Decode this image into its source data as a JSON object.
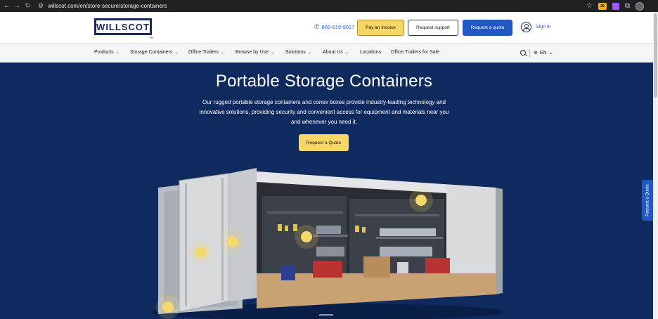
{
  "browser": {
    "url": "willscot.com/en/store-secure/storage-containers",
    "ext_badge": "20"
  },
  "header": {
    "logo_text": "WILLSCOT",
    "logo_tm": "TM",
    "phone": "866-619-9017",
    "pay_invoice": "Pay an Invoice",
    "request_support": "Request support",
    "request_quote": "Request a quote",
    "sign_in": "Sign in"
  },
  "nav": {
    "items": [
      {
        "label": "Products"
      },
      {
        "label": "Storage Containers"
      },
      {
        "label": "Office Trailers"
      },
      {
        "label": "Browse by Use"
      },
      {
        "label": "Solutions"
      },
      {
        "label": "About Us"
      },
      {
        "label": "Locations"
      },
      {
        "label": "Office Trailers for Sale"
      }
    ],
    "language": "EN"
  },
  "hero": {
    "title": "Portable Storage Containers",
    "description": "Our rugged portable storage containers and conex boxes provide industry-leading technology and innovative solutions, providing security and convenient access for equipment and materials near you and whenever you need it.",
    "cta": "Request a Quote",
    "side_tab": "Request a Quote"
  },
  "colors": {
    "brand_navy": "#0e2a5e",
    "brand_blue": "#2358c4",
    "accent_yellow": "#f8d666"
  }
}
